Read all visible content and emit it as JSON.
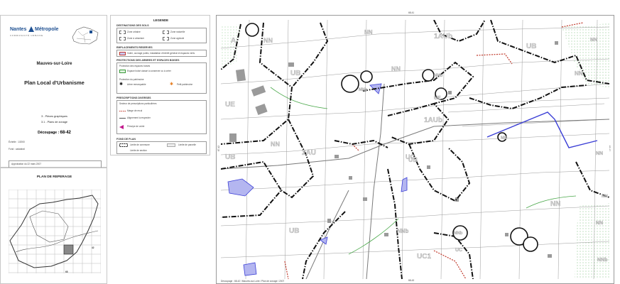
{
  "cartouche": {
    "brand_left": "Nantes",
    "brand_right": "Métropole",
    "brand_tagline": "COMMUNAUTÉ URBAINE",
    "commune": "Mauves-sur-Loire",
    "plan_title": "Plan Local d'Urbanisme",
    "piece": "3 - Pièces graphiques",
    "piece_sub": "3.1 - Plans de zonage",
    "decoupage_label": "Découpage :",
    "decoupage_value": "68-42",
    "echelle": "Échelle : 1/2000",
    "fond": "Fond : cadastral",
    "approbation": "Approbation du 22 mars 2007",
    "reperage_title": "PLAN DE REPERAGE",
    "reperage_cells": [
      "42",
      "68"
    ]
  },
  "legend": {
    "title": "LEGENDE",
    "sections": [
      {
        "heading": "DESTINATIONS DES SOLS",
        "items": [
          "Zone urbaine",
          "Zone à urbaniser",
          "Zone naturelle",
          "Zone agricole"
        ]
      },
      {
        "heading": "EMPLACEMENTS RESERVES",
        "items": [
          "Voirie, ouvrage public, installation d'intérêt général et espaces verts"
        ]
      },
      {
        "heading": "PROTECTIONS DES ARBRES ET ESPACES BOISES",
        "items": [
          "Protection des espaces boisés",
          "Espace boisé classé à conserver ou à créer",
          "Protection du patrimoine",
          "Arbre remarquable",
          "Petit patrimoine"
        ]
      },
      {
        "heading": "PRESCRIPTIONS DIVERSES",
        "items": [
          "Secteur de prescriptions particulières",
          "Marge de recul",
          "Alignement à respecter",
          "Principe de voirie"
        ]
      },
      {
        "heading": "FOND DE PLAN",
        "items": [
          "Limite de commune",
          "Limite de parcelle",
          "Limite de section"
        ]
      }
    ]
  },
  "map": {
    "sheet_top": "68-41",
    "sheet_bottom": "68-43",
    "sheet_left": "67-42",
    "sheet_right": "69-42",
    "footer": "Découpage : 68-42 / Mauves-sur-Loire / Plan de zonage / 2007",
    "zones": [
      "A",
      "NN",
      "1AUb",
      "UE",
      "NN",
      "UB",
      "UB",
      "NN",
      "NN",
      "UB",
      "NN",
      "1AUb",
      "UE",
      "NN",
      "UB",
      "NN",
      "2AU",
      "UC",
      "NN",
      "NN",
      "UB",
      "NNb",
      "UC1",
      "NNb",
      "NN",
      "NNb",
      "NNb",
      "NN",
      "UC",
      "NNb"
    ]
  }
}
